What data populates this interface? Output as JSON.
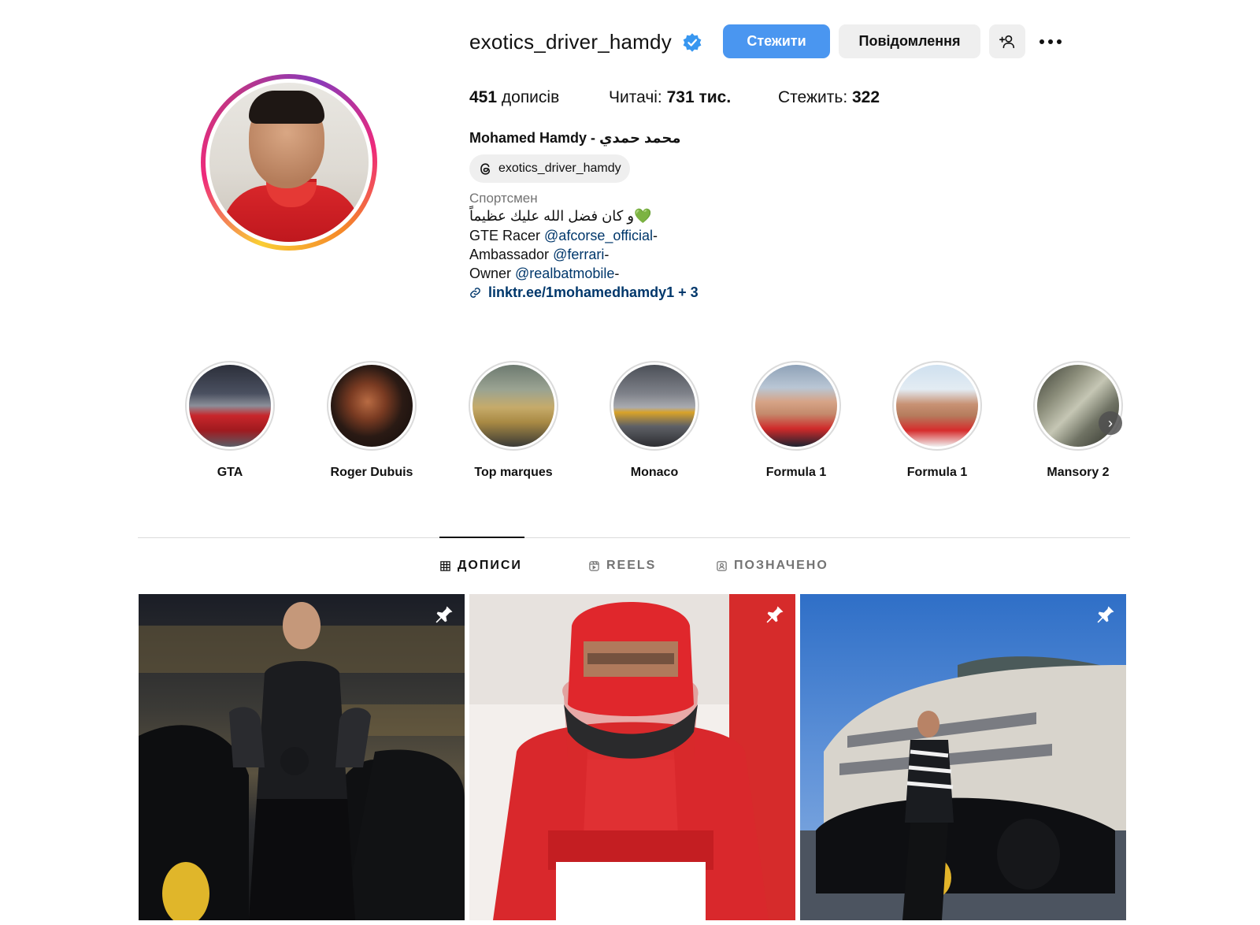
{
  "profile": {
    "username": "exotics_driver_hamdy",
    "verified": true,
    "follow_label": "Стежити",
    "message_label": "Повідомлення",
    "posts_count": "451",
    "posts_label": " дописів",
    "followers_label": "Читачі: ",
    "followers_count": "731 тис.",
    "following_label": "Стежить: ",
    "following_count": "322",
    "full_name": "Mohamed Hamdy - محمد حمدي",
    "threads_handle": "exotics_driver_hamdy",
    "category": "Спортсмен",
    "bio_arabic": "و كان فضل الله عليك عظيماً💚",
    "bio_lines": [
      {
        "prefix": "GTE Racer ",
        "mention": "@afcorse_official",
        "suffix": "-"
      },
      {
        "prefix": "Ambassador ",
        "mention": "@ferrari",
        "suffix": "-"
      },
      {
        "prefix": "Owner ",
        "mention": "@realbatmobile",
        "suffix": "-"
      }
    ],
    "link": "linktr.ee/1mohamedhamdy1 + 3"
  },
  "highlights": [
    {
      "label": "GTA"
    },
    {
      "label": "Roger Dubuis"
    },
    {
      "label": "Top marques"
    },
    {
      "label": "Monaco"
    },
    {
      "label": "Formula 1"
    },
    {
      "label": "Formula 1"
    },
    {
      "label": "Mansory 2"
    }
  ],
  "tabs": {
    "posts": "ДОПИСИ",
    "reels": "REELS",
    "tagged": "ПОЗНАЧЕНО"
  },
  "posts": [
    {
      "pinned": true,
      "caption_text": ""
    },
    {
      "pinned": true,
      "caption_text": ""
    },
    {
      "pinned": true,
      "caption_text": ""
    }
  ],
  "colors": {
    "follow_button": "#4a96f0",
    "secondary_button": "#efefef",
    "mention_link": "#00376b",
    "muted_text": "#737373"
  }
}
